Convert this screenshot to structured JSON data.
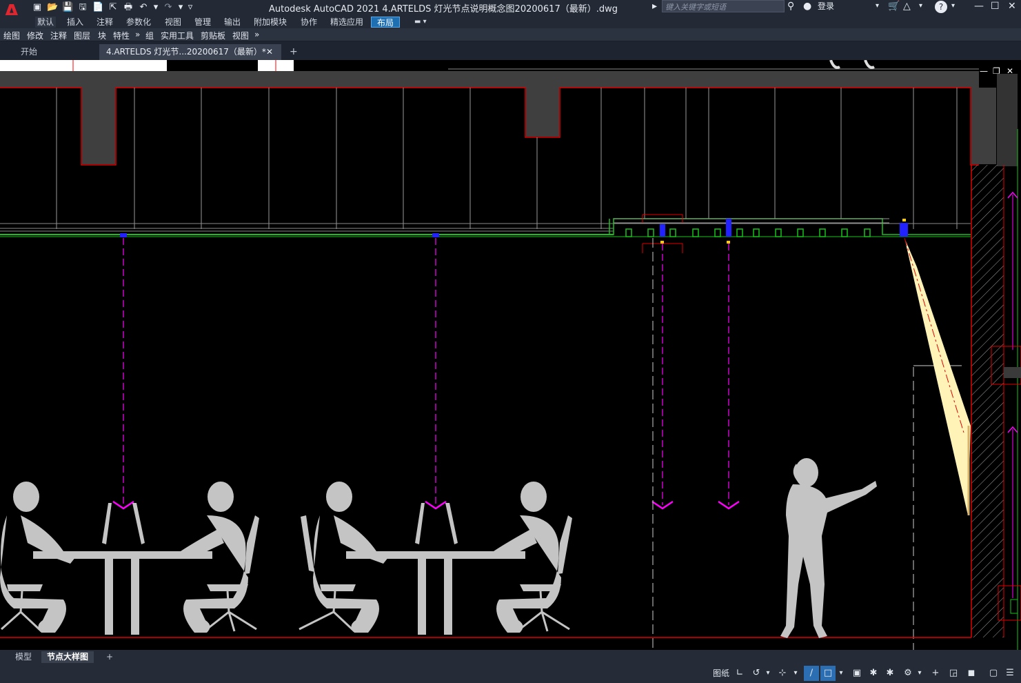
{
  "app": {
    "logo_letter": "A",
    "window_title": "Autodesk AutoCAD 2021    4.ARTELDS 灯光节点说明概念图20200617（最新）.dwg",
    "search_placeholder": "键入关键字或短语",
    "login_label": "登录",
    "help_label": "?"
  },
  "ribbon_tabs": [
    {
      "label": "默认",
      "active": true
    },
    {
      "label": "插入"
    },
    {
      "label": "注释"
    },
    {
      "label": "参数化"
    },
    {
      "label": "视图"
    },
    {
      "label": "管理"
    },
    {
      "label": "输出"
    },
    {
      "label": "附加模块"
    },
    {
      "label": "协作"
    },
    {
      "label": "精选应用"
    },
    {
      "label": "布局",
      "highlight": true
    }
  ],
  "panels": [
    "绘图",
    "修改",
    "注释",
    "图层",
    "块",
    "特性",
    "»",
    "组",
    "实用工具",
    "剪贴板",
    "视图",
    "»"
  ],
  "file_tabs": {
    "start": "开始",
    "current": "4.ARTELDS 灯光节...20200617（最新）*",
    "close_symbol": "✕",
    "add_symbol": "+"
  },
  "layout_tabs": {
    "model": "模型",
    "current": "节点大样图",
    "add_symbol": "+"
  },
  "status": {
    "paper_label": "图纸"
  },
  "colors": {
    "titlebar": "#232a36",
    "accent": "#1d6fb2",
    "wall_red": "#e00000",
    "ceiling_green": "#19c21a",
    "axis_magenta": "#ff00ff",
    "light_beam": "#fff3b8",
    "silhouette": "#c4c4c4"
  },
  "icons": [
    "new-icon",
    "open-icon",
    "save-icon",
    "saveas-icon",
    "plot-icon",
    "undo-icon",
    "redo-icon",
    "search-icon",
    "user-icon",
    "cart-icon",
    "exchange-icon",
    "help-icon",
    "minimize-icon",
    "maximize-icon",
    "close-icon"
  ]
}
